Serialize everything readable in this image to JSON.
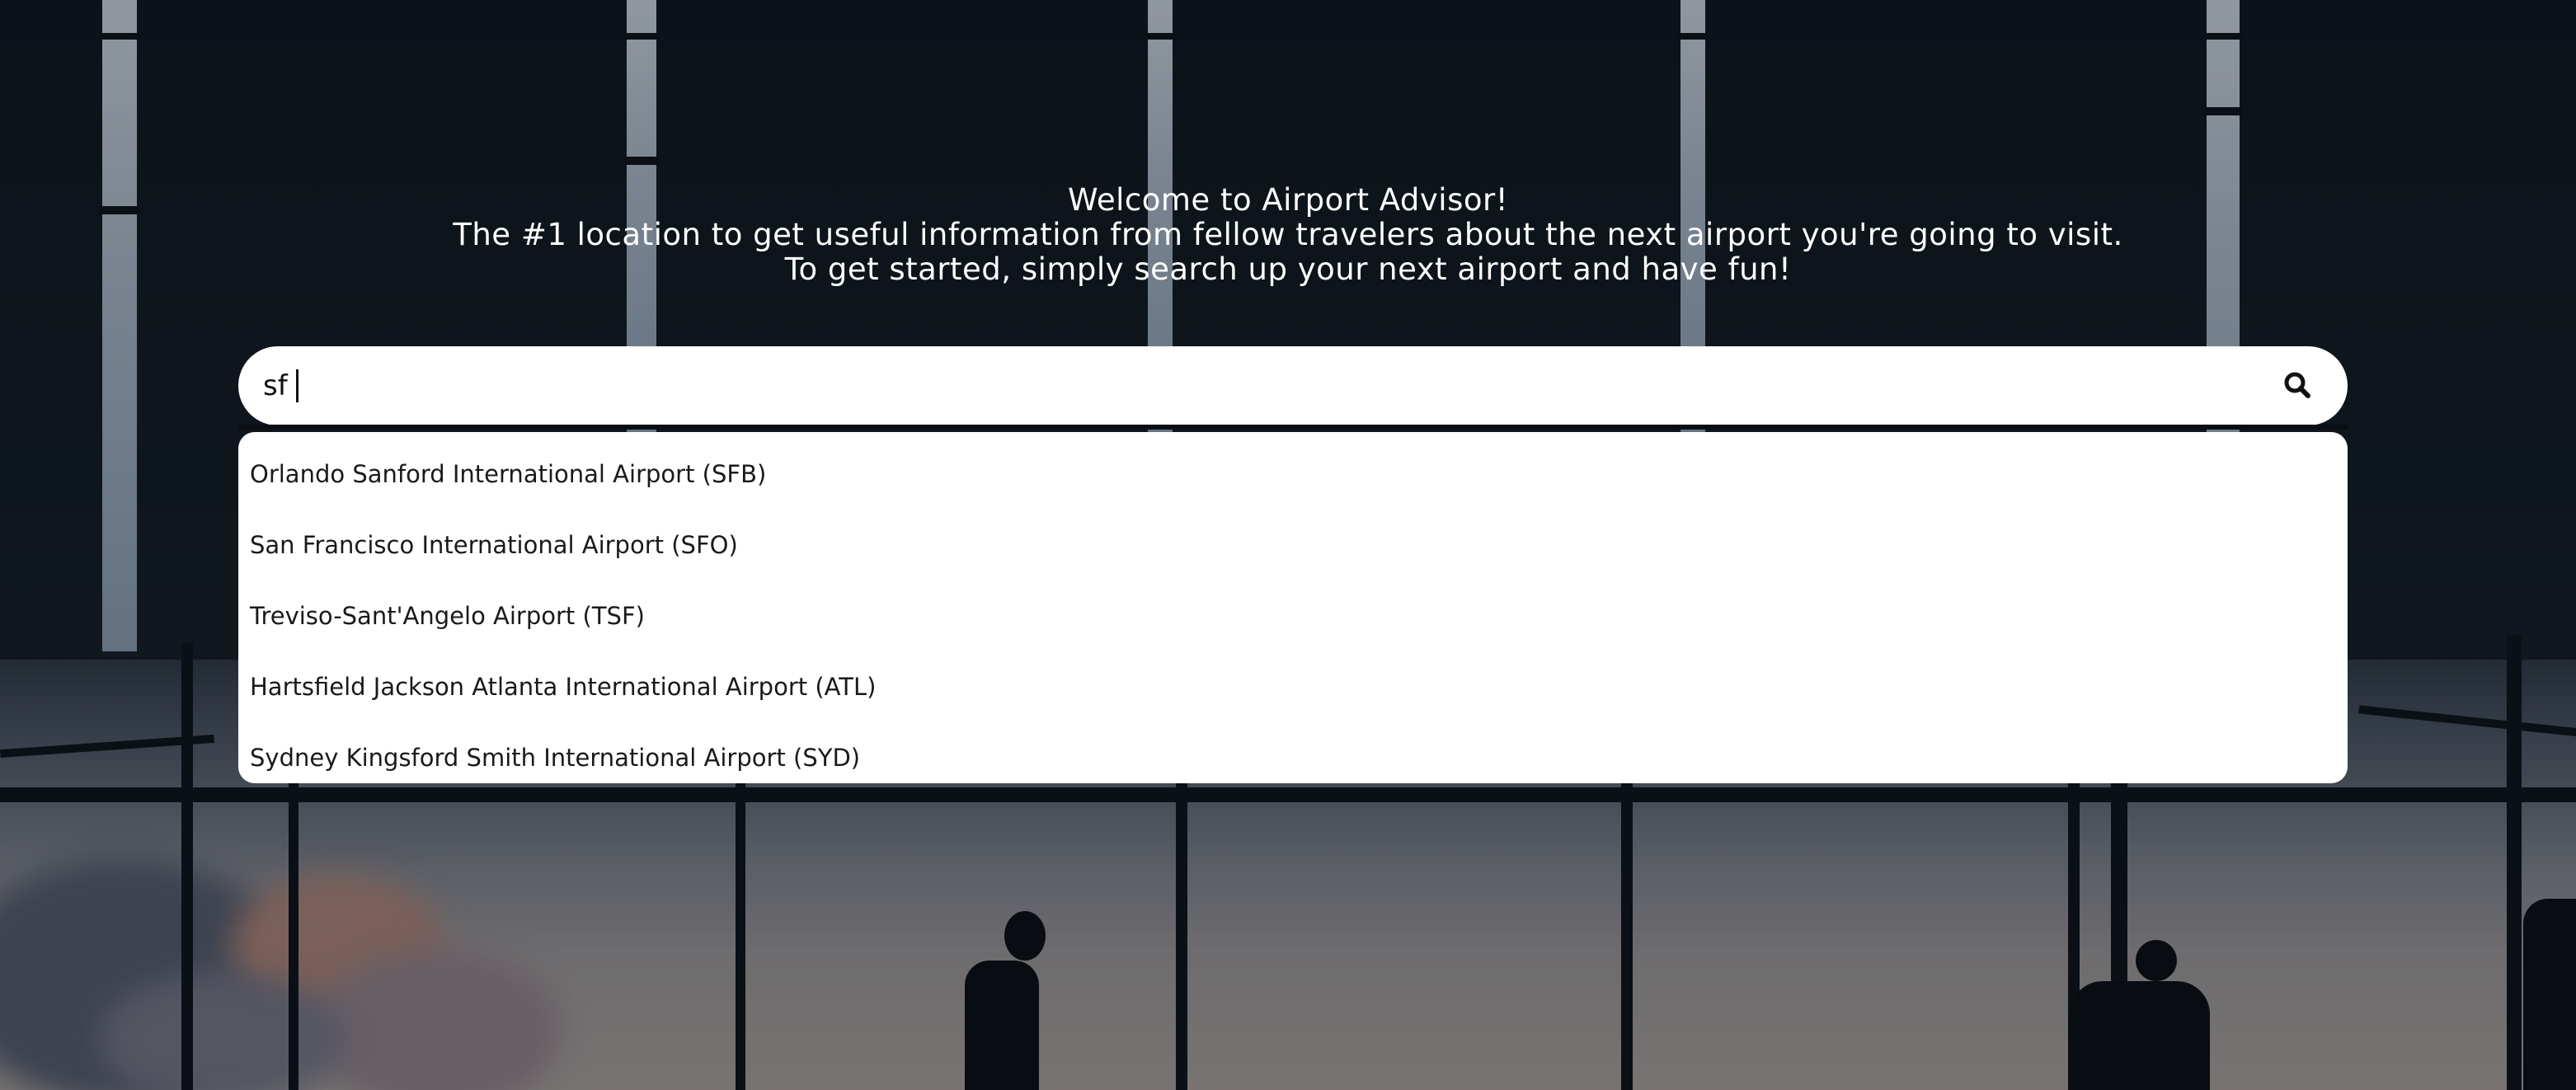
{
  "welcome": {
    "line1": "Welcome to Airport Advisor!",
    "line2": "The #1 location to get useful information from fellow travelers about the next airport you're going to visit.",
    "line3": "To get started, simply search up your next airport and have fun!"
  },
  "search": {
    "value": "sf",
    "button_icon": "search-icon"
  },
  "suggestions": [
    "Orlando Sanford International Airport (SFB)",
    "San Francisco International Airport (SFO)",
    "Treviso-Sant'Angelo Airport (TSF)",
    "Hartsfield Jackson Atlanta International Airport (ATL)",
    "Sydney Kingsford Smith International Airport (SYD)"
  ],
  "colors": {
    "text_on_dark": "#ffffff",
    "panel": "#ffffff",
    "background_dark": "#111a22"
  }
}
